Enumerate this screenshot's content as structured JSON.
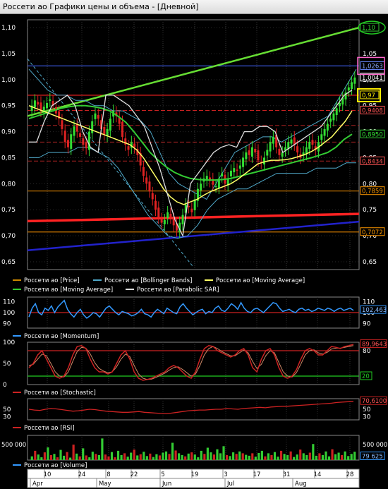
{
  "window": {
    "title": "Россети ао Графики цены и объема - [Дневной]"
  },
  "colors": {
    "price_up": "#33dd33",
    "price_down": "#dd2222",
    "bollinger": "#4fa8c8",
    "ma_fast": "#ffff66",
    "ma_slow": "#33cc33",
    "sar": "#dddddd",
    "resistance": "#ff2222",
    "support": "#2222cc",
    "trend_up": "#66dd33",
    "momentum": "#3399ff",
    "stochastic": "#cc2222",
    "rsi": "#cc2222",
    "volume_up": "#33cc33",
    "volume_down": "#cc2222"
  },
  "chart_data": [
    {
      "type": "candlestick",
      "panel": "price",
      "y_ticks_left": [
        "1,10",
        "1,05",
        "1,00",
        "0,95",
        "0,90",
        "0,85",
        "0,80",
        "0,75",
        "0,70",
        "0,65"
      ],
      "y_ticks_right": [
        "1,05",
        "1,00",
        "0,95",
        "0,90",
        "0,85",
        "0,80",
        "0,75",
        "0,70",
        "0,65"
      ],
      "ylim": [
        0.635,
        1.115
      ],
      "price_tags": [
        {
          "value": "1,10",
          "y": 1.1,
          "color": "#33cc33"
        },
        {
          "value": "1,0263",
          "y": 1.0263,
          "color": "#6688ff"
        },
        {
          "value": "1,0041",
          "y": 1.0041,
          "color": "#ffffff"
        },
        {
          "value": "0,97",
          "y": 0.97,
          "color": "#ffee00"
        },
        {
          "value": "0,9408",
          "y": 0.9408,
          "color": "#ff5555"
        },
        {
          "value": "0,8950",
          "y": 0.895,
          "color": "#33cc33"
        },
        {
          "value": "0,8434",
          "y": 0.8434,
          "color": "#ff5555"
        },
        {
          "value": "0,7859",
          "y": 0.7859,
          "color": "#ff9900"
        },
        {
          "value": "0,7072",
          "y": 0.7072,
          "color": "#ff9900"
        }
      ],
      "levels": [
        {
          "y": 1.0263,
          "color": "#4466ff",
          "style": "solid"
        },
        {
          "y": 0.97,
          "color": "#ff2222",
          "style": "solid"
        },
        {
          "y": 0.9408,
          "color": "#cc2222",
          "style": "dash"
        },
        {
          "y": 0.912,
          "color": "#aa2222",
          "style": "dash"
        },
        {
          "y": 0.88,
          "color": "#aa2222",
          "style": "dash"
        },
        {
          "y": 0.8434,
          "color": "#aa2222",
          "style": "dash"
        },
        {
          "y": 0.7859,
          "color": "#cc7700",
          "style": "solid"
        },
        {
          "y": 0.7072,
          "color": "#cc7700",
          "style": "solid"
        }
      ],
      "close": [
        0.95,
        0.96,
        0.952,
        0.94,
        0.948,
        0.955,
        0.962,
        0.95,
        0.935,
        0.925,
        0.905,
        0.88,
        0.87,
        0.895,
        0.91,
        0.9,
        0.89,
        0.875,
        0.868,
        0.9,
        0.92,
        0.935,
        0.925,
        0.905,
        0.895,
        0.905,
        0.925,
        0.94,
        0.93,
        0.915,
        0.89,
        0.875,
        0.865,
        0.88,
        0.87,
        0.855,
        0.835,
        0.815,
        0.8,
        0.785,
        0.77,
        0.75,
        0.735,
        0.725,
        0.73,
        0.745,
        0.735,
        0.72,
        0.71,
        0.725,
        0.74,
        0.76,
        0.755,
        0.745,
        0.77,
        0.79,
        0.8,
        0.81,
        0.815,
        0.805,
        0.798,
        0.795,
        0.81,
        0.82,
        0.8,
        0.81,
        0.825,
        0.83,
        0.825,
        0.835,
        0.85,
        0.86,
        0.855,
        0.87,
        0.86,
        0.845,
        0.84,
        0.85,
        0.865,
        0.88,
        0.89,
        0.87,
        0.855,
        0.86,
        0.87,
        0.88,
        0.885,
        0.875,
        0.86,
        0.85,
        0.86,
        0.87,
        0.88,
        0.875,
        0.865,
        0.88,
        0.895,
        0.905,
        0.915,
        0.925,
        0.935,
        0.945,
        0.955,
        0.965,
        0.975,
        0.985,
        0.995,
        1.004
      ],
      "ma_fast": [
        0.95,
        0.945,
        0.94,
        0.935,
        0.93,
        0.925,
        0.92,
        0.915,
        0.91,
        0.905,
        0.9,
        0.895,
        0.89,
        0.885,
        0.88,
        0.875,
        0.865,
        0.85,
        0.83,
        0.81,
        0.79,
        0.775,
        0.765,
        0.76,
        0.765,
        0.77,
        0.778,
        0.785,
        0.79,
        0.795,
        0.8,
        0.808,
        0.818,
        0.828,
        0.838,
        0.842,
        0.845,
        0.845,
        0.846,
        0.848,
        0.852,
        0.856,
        0.862,
        0.87,
        0.88,
        0.89,
        0.905,
        0.92,
        0.94
      ],
      "ma_slow": [
        0.925,
        0.93,
        0.935,
        0.94,
        0.945,
        0.948,
        0.95,
        0.95,
        0.948,
        0.945,
        0.94,
        0.93,
        0.918,
        0.9,
        0.88,
        0.86,
        0.845,
        0.832,
        0.822,
        0.815,
        0.81,
        0.808,
        0.807,
        0.807,
        0.808,
        0.81,
        0.814,
        0.818,
        0.822,
        0.826,
        0.83,
        0.834,
        0.838,
        0.842,
        0.846,
        0.85,
        0.855,
        0.86,
        0.87,
        0.885,
        0.895
      ],
      "bb_upper": [
        1.02,
        1.0,
        0.98,
        0.97,
        0.97,
        0.96,
        0.96,
        0.95,
        0.95,
        0.94,
        0.94,
        0.93,
        0.92,
        0.9,
        0.86,
        0.82,
        0.8,
        0.79,
        0.78,
        0.77,
        0.8,
        0.83,
        0.86,
        0.87,
        0.88,
        0.89,
        0.89,
        0.88,
        0.89,
        0.9,
        0.91,
        0.92,
        0.93,
        0.96,
        0.99,
        1.02
      ],
      "bb_lower": [
        0.85,
        0.85,
        0.86,
        0.86,
        0.86,
        0.87,
        0.87,
        0.86,
        0.85,
        0.83,
        0.8,
        0.77,
        0.74,
        0.72,
        0.7,
        0.695,
        0.7,
        0.72,
        0.75,
        0.77,
        0.78,
        0.79,
        0.79,
        0.8,
        0.81,
        0.82,
        0.82,
        0.82,
        0.82,
        0.83,
        0.83,
        0.83,
        0.84,
        0.84
      ],
      "sar": [
        0.88,
        0.88,
        0.92,
        0.95,
        0.96,
        0.97,
        0.95,
        0.9,
        0.87,
        0.86,
        0.97,
        0.97,
        0.96,
        0.95,
        0.93,
        0.91,
        0.87,
        0.83,
        0.78,
        0.73,
        0.7,
        0.8,
        0.82,
        0.84,
        0.86,
        0.87,
        0.875,
        0.87,
        0.9,
        0.9,
        0.91,
        0.91,
        0.9,
        0.86,
        0.87,
        0.88,
        0.89,
        0.9,
        0.91,
        0.93,
        0.95,
        0.97,
        0.98
      ],
      "trend_up": [
        [
          0.0,
          0.93
        ],
        [
          1.0,
          1.1
        ]
      ],
      "support_line": [
        [
          0.0,
          0.672
        ],
        [
          1.0,
          0.727
        ]
      ],
      "resistance_line": [
        [
          0.0,
          0.728
        ],
        [
          1.0,
          0.742
        ]
      ],
      "descending_line": [
        [
          0.0,
          1.04
        ],
        [
          0.5,
          0.64
        ]
      ],
      "legend": [
        "Россети ао [Price]",
        "Россети ао [Bollinger Bands]",
        "Россети ао [Moving Average]",
        "Россети ао [Moving Average]",
        "Россети ао [Parabolic SAR]"
      ]
    },
    {
      "type": "line",
      "panel": "momentum",
      "name": "Россети ао [Momentum]",
      "y_ticks": [
        "110",
        "100",
        "90"
      ],
      "ylim": [
        86,
        114
      ],
      "tag": "102,463",
      "values": [
        96,
        104,
        108,
        100,
        98,
        104,
        102,
        106,
        100,
        105,
        108,
        111,
        103,
        99,
        96,
        100,
        103,
        98,
        95,
        97,
        100,
        99,
        96,
        100,
        104,
        106,
        103,
        100,
        98,
        101,
        100,
        99,
        97,
        98,
        100,
        103,
        99,
        98,
        96,
        100,
        103,
        101,
        99,
        104,
        102,
        100,
        99,
        105,
        108,
        104,
        101,
        98,
        100,
        102,
        103,
        99,
        101,
        100,
        104,
        106,
        102,
        101,
        104,
        108,
        106,
        103,
        109,
        104,
        101,
        100,
        103,
        104,
        102,
        100,
        103,
        106,
        109,
        108,
        104,
        101,
        102,
        103,
        101,
        100,
        103,
        104,
        102,
        103,
        101,
        102,
        104,
        103,
        102,
        104,
        103,
        101,
        103,
        104,
        102,
        103,
        104,
        102
      ]
    },
    {
      "type": "line",
      "panel": "stochastic",
      "name": "Россети ао [Stochastic]",
      "y_ticks": [
        "100",
        "50",
        "0"
      ],
      "right_ticks": [
        "80",
        "20"
      ],
      "ylim": [
        0,
        100
      ],
      "tag": "89,9643",
      "k": [
        40,
        50,
        70,
        80,
        60,
        40,
        20,
        15,
        20,
        40,
        70,
        90,
        92,
        85,
        60,
        40,
        30,
        30,
        25,
        30,
        50,
        70,
        80,
        60,
        30,
        15,
        10,
        12,
        15,
        20,
        25,
        30,
        40,
        45,
        40,
        30,
        20,
        15,
        30,
        60,
        85,
        92,
        90,
        80,
        75,
        70,
        65,
        70,
        80,
        85,
        70,
        40,
        30,
        60,
        80,
        85,
        70,
        40,
        20,
        15,
        20,
        35,
        60,
        80,
        85,
        80,
        70,
        70,
        80,
        90,
        88,
        85,
        90,
        92,
        95
      ],
      "d": [
        45,
        48,
        60,
        72,
        68,
        50,
        30,
        20,
        18,
        30,
        55,
        78,
        88,
        86,
        72,
        52,
        38,
        32,
        28,
        30,
        42,
        60,
        72,
        66,
        45,
        25,
        15,
        12,
        13,
        17,
        22,
        27,
        34,
        40,
        42,
        36,
        28,
        20,
        25,
        45,
        70,
        85,
        90,
        85,
        78,
        73,
        68,
        68,
        75,
        82,
        75,
        55,
        38,
        48,
        68,
        80,
        75,
        52,
        30,
        20,
        18,
        28,
        48,
        70,
        80,
        82,
        75,
        72,
        76,
        84,
        86,
        86,
        88,
        90,
        92
      ]
    },
    {
      "type": "line",
      "panel": "rsi",
      "name": "Россети ао [RSI]",
      "y_ticks": [
        "50",
        "30"
      ],
      "ylim": [
        22,
        78
      ],
      "tag": "70,6100",
      "values": [
        50,
        48,
        47,
        50,
        52,
        51,
        49,
        47,
        45,
        46,
        48,
        50,
        49,
        47,
        45,
        44,
        43,
        42,
        42,
        43,
        44,
        42,
        41,
        40,
        39,
        38,
        40,
        42,
        44,
        46,
        47,
        48,
        48,
        49,
        50,
        50,
        52,
        51,
        50,
        52,
        53,
        54,
        55,
        54,
        56,
        57,
        58,
        58,
        59,
        60,
        61,
        62,
        63,
        64,
        65,
        66,
        68,
        69,
        70,
        71
      ]
    },
    {
      "type": "bar",
      "panel": "volume",
      "name": "Россети ао [Volume]",
      "y_ticks": [
        "500 000"
      ],
      "tag": "79 625",
      "ylim": [
        0,
        800000
      ],
      "values": [
        120000,
        300000,
        180000,
        90000,
        250000,
        410000,
        160000,
        200000,
        90000,
        330000,
        140000,
        260000,
        80000,
        500000,
        210000,
        120000,
        380000,
        150000,
        90000,
        270000,
        200000,
        160000,
        700000,
        180000,
        120000,
        260000,
        90000,
        300000,
        160000,
        220000,
        110000,
        240000,
        340000,
        150000,
        190000,
        270000,
        130000,
        210000,
        100000,
        190000,
        150000,
        240000,
        280000,
        200000,
        560000,
        310000,
        220000,
        160000,
        120000,
        210000,
        250000,
        180000,
        90000,
        300000,
        200000,
        400000,
        250000,
        180000,
        350000,
        220000,
        450000,
        160000,
        130000,
        250000,
        200000,
        280000,
        220000,
        170000,
        140000,
        220000,
        110000,
        230000,
        300000,
        120000,
        220000,
        160000,
        260000,
        110000,
        300000,
        200000,
        160000,
        280000,
        100000,
        180000,
        340000,
        220000,
        160000,
        240000,
        520000,
        140000,
        220000,
        160000,
        280000,
        120000,
        350000,
        190000,
        240000,
        160000,
        280000,
        130000,
        200000,
        270000
      ],
      "up": [
        1,
        0,
        1,
        1,
        0,
        1,
        0,
        1,
        0,
        1,
        1,
        0,
        1,
        0,
        1,
        0,
        1,
        0,
        1,
        1,
        0,
        1,
        1,
        0,
        0,
        1,
        0,
        1,
        1,
        0,
        1,
        1,
        0,
        1,
        0,
        1,
        1,
        0,
        1,
        1,
        0,
        1,
        1,
        0,
        1,
        0,
        1,
        1,
        0,
        1,
        0,
        1,
        1,
        1,
        0,
        1,
        1,
        0,
        1,
        1,
        1,
        0,
        1,
        1,
        0,
        1,
        0,
        1,
        1,
        0,
        1,
        1,
        1,
        0,
        1,
        0,
        1,
        1,
        0,
        1,
        1,
        0,
        1,
        1,
        0,
        1,
        1,
        0,
        1,
        1,
        0,
        1,
        1,
        1,
        0,
        1,
        1,
        0,
        1,
        1,
        1,
        1
      ]
    },
    {
      "type": "axis",
      "panel": "dates",
      "days": [
        "10",
        "24",
        "8",
        "22",
        "5",
        "19",
        "3",
        "17",
        "31",
        "14",
        "28"
      ],
      "months": [
        "Apr",
        "May",
        "Jun",
        "Jul",
        "Aug"
      ]
    }
  ]
}
